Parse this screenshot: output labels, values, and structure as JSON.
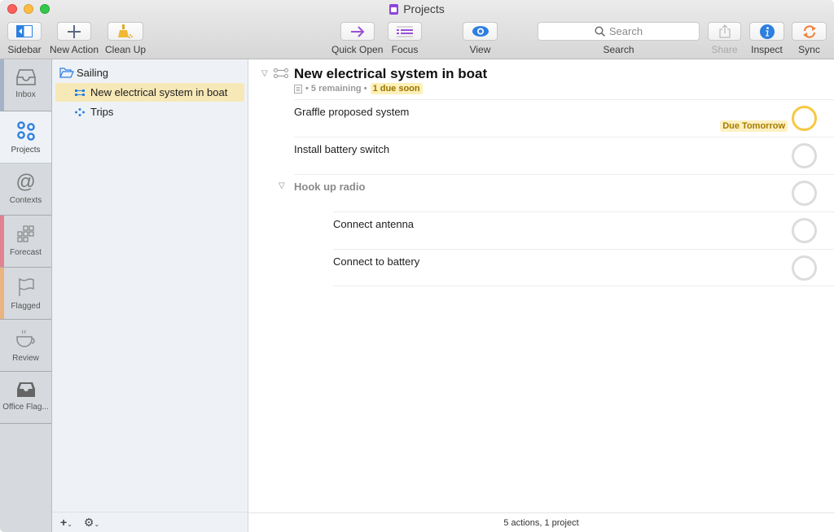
{
  "window": {
    "title": "Projects"
  },
  "toolbar": {
    "sidebar_label": "Sidebar",
    "new_action_label": "New Action",
    "clean_up_label": "Clean Up",
    "quick_open_label": "Quick Open",
    "focus_label": "Focus",
    "view_label": "View",
    "search_placeholder": "Search",
    "search_label": "Search",
    "share_label": "Share",
    "inspect_label": "Inspect",
    "sync_label": "Sync"
  },
  "perspectives": [
    {
      "label": "Inbox",
      "icon": "inbox-icon",
      "stripe": "#a5b3c8"
    },
    {
      "label": "Projects",
      "icon": "projects-icon",
      "selected": true
    },
    {
      "label": "Contexts",
      "icon": "at-icon"
    },
    {
      "label": "Forecast",
      "icon": "forecast-grid-icon",
      "stripe": "#e0828f"
    },
    {
      "label": "Flagged",
      "icon": "flag-icon",
      "stripe": "#ebb37f"
    },
    {
      "label": "Review",
      "icon": "coffee-cup-icon"
    },
    {
      "label": "Office Flag...",
      "icon": "tray-icon"
    }
  ],
  "sidebar": {
    "folder": "Sailing",
    "projects": [
      {
        "label": "New electrical system in boat",
        "selected": true
      },
      {
        "label": "Trips"
      }
    ],
    "add_button": "+",
    "settings_button": "⚙"
  },
  "main": {
    "project_title": "New electrical system in boat",
    "meta_remaining": "• 5 remaining •",
    "meta_due": "1 due soon",
    "tasks": [
      {
        "title": "Graffle proposed system",
        "due": "Due Tomorrow"
      },
      {
        "title": "Install battery switch"
      },
      {
        "title": "Hook up radio",
        "group": true
      },
      {
        "title": "Connect antenna"
      },
      {
        "title": "Connect to battery"
      }
    ],
    "status": "5 actions, 1 project"
  },
  "colors": {
    "accent_blue": "#2d7fe0",
    "due_yellow": "#f7c843",
    "quick_open_purple": "#9b4fd6",
    "sync_orange": "#f0823a",
    "selected_row": "#f7e8b7"
  }
}
